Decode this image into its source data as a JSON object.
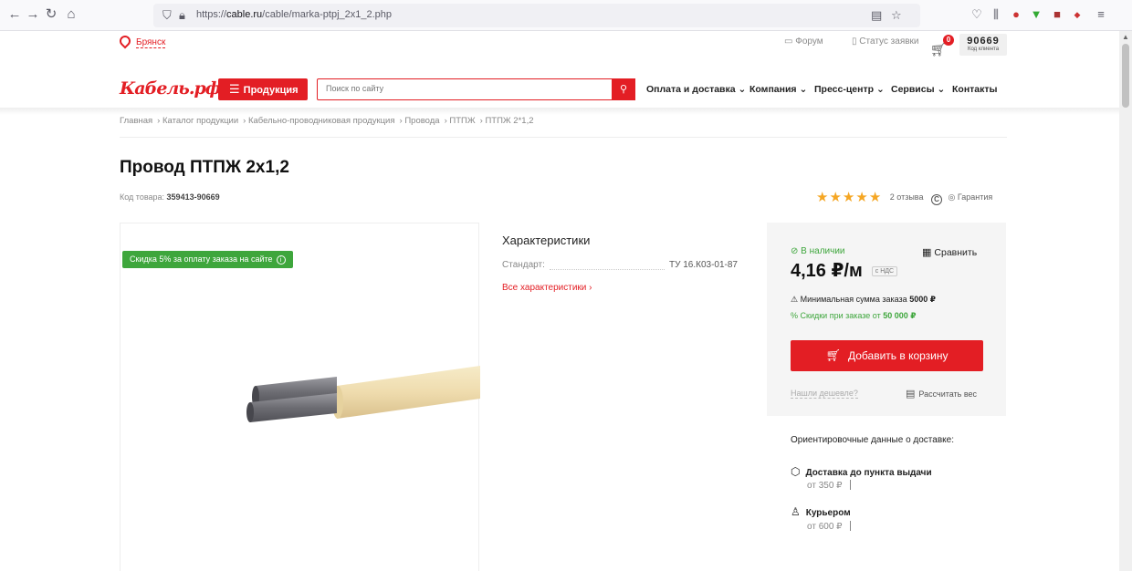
{
  "browser": {
    "url_prefix": "https://",
    "url_domain": "cable.ru",
    "url_path": "/cable/marka-ptpj_2x1_2.php"
  },
  "header": {
    "city": "Брянск",
    "forum": "Форум",
    "order_status": "Статус заявки",
    "cart_count": "0",
    "client_code": "90669",
    "client_code_label": "Код клиента",
    "logo": "Кабель.рф",
    "products_button": "Продукция",
    "search_placeholder": "Поиск по сайту",
    "menu": [
      "Оплата и доставка",
      "Компания",
      "Пресс-центр",
      "Сервисы",
      "Контакты"
    ]
  },
  "breadcrumb": [
    "Главная",
    "Каталог продукции",
    "Кабельно-проводниковая продукция",
    "Провода",
    "ПТПЖ",
    "ПТПЖ 2*1,2"
  ],
  "product": {
    "title": "Провод ПТПЖ 2х1,2",
    "code_label": "Код товара:",
    "code": "359413-90669",
    "stars": 5,
    "reviews": "2 отзыва",
    "guarantee": "Гарантия",
    "discount_badge": "Скидка 5% за оплату заказа на сайте"
  },
  "characteristics": {
    "title": "Характеристики",
    "rows": [
      {
        "label": "Стандарт:",
        "value": "ТУ 16.К03-01-87"
      }
    ],
    "all_link": "Все характеристики ›"
  },
  "buybox": {
    "in_stock": "В наличии",
    "compare": "Сравнить",
    "price": "4,16 ₽/м",
    "vat": "с НДС",
    "min_sum_label": "Минимальная сумма заказа",
    "min_sum_value": "5000 ₽",
    "discounts_label": "Скидки при заказе от",
    "discounts_value": "50 000 ₽",
    "add_to_cart": "Добавить в корзину",
    "cheaper": "Нашли дешевле?",
    "calc_weight": "Рассчитать вес"
  },
  "delivery": {
    "title": "Ориентировочные данные о доставке:",
    "options": [
      {
        "label": "Доставка до пункта выдачи",
        "price": "от 350 ₽"
      },
      {
        "label": "Курьером",
        "price": "от 600 ₽"
      }
    ]
  },
  "colors": {
    "accent": "#e31e24",
    "green": "#3ea63c",
    "star": "#f5a623"
  }
}
